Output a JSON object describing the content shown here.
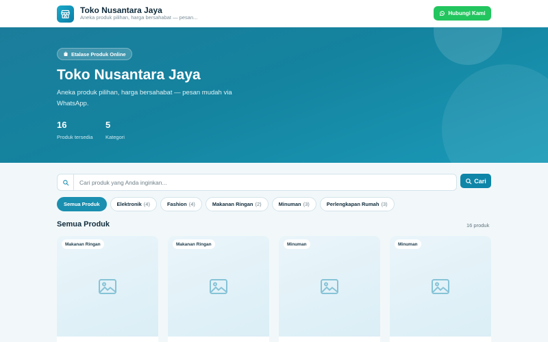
{
  "header": {
    "title": "Toko Nusantara Jaya",
    "subtitle": "Aneka produk pilihan, harga bersahabat — pesan...",
    "cta_label": "Hubungi Kami"
  },
  "hero": {
    "chip_label": "Etalase Produk Online",
    "title": "Toko Nusantara Jaya",
    "description": "Aneka produk pilihan, harga bersahabat — pesan mudah via WhatsApp.",
    "stats": [
      {
        "value": "16",
        "label": "Produk tersedia"
      },
      {
        "value": "5",
        "label": "Kategori"
      }
    ]
  },
  "search": {
    "placeholder": "Cari produk yang Anda inginkan...",
    "button_label": "Cari"
  },
  "categories": [
    {
      "label": "Semua Produk",
      "count": "",
      "active": true
    },
    {
      "label": "Elektronik",
      "count": "(4)",
      "active": false
    },
    {
      "label": "Fashion",
      "count": "(4)",
      "active": false
    },
    {
      "label": "Makanan Ringan",
      "count": "(2)",
      "active": false
    },
    {
      "label": "Minuman",
      "count": "(3)",
      "active": false
    },
    {
      "label": "Perlengkapan Rumah",
      "count": "(3)",
      "active": false
    }
  ],
  "section": {
    "title": "Semua Produk",
    "count_label": "16 produk"
  },
  "products": [
    {
      "category": "Makanan Ringan",
      "icon": "image-placeholder-icon"
    },
    {
      "category": "Makanan Ringan",
      "icon": "image-placeholder-icon"
    },
    {
      "category": "Minuman",
      "icon": "image-placeholder-icon"
    },
    {
      "category": "Minuman",
      "icon": "image-placeholder-icon"
    }
  ],
  "colors": {
    "primary": "#1a8fb0",
    "whatsapp": "#22c55e",
    "hero_gradient_start": "#1b7d9b",
    "hero_gradient_end": "#1a9ab8"
  }
}
